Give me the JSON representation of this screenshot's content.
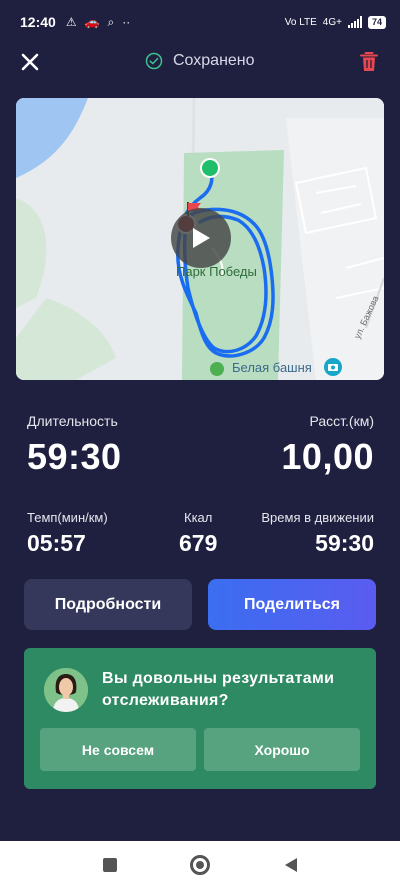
{
  "status_bar": {
    "time": "12:40",
    "network": "4G+",
    "volte": "Vo LTE",
    "battery": "74"
  },
  "topbar": {
    "saved_text": "Сохранено"
  },
  "map": {
    "park_label": "Парк Победы",
    "tower_label": "Белая башня",
    "street_label": "ул. Бажова"
  },
  "stats": {
    "duration_label": "Длительность",
    "duration_value": "59:30",
    "distance_label": "Расст.(км)",
    "distance_value": "10,00",
    "pace_label": "Темп(мин/км)",
    "pace_value": "05:57",
    "kcal_label": "Ккал",
    "kcal_value": "679",
    "moving_label": "Время в движении",
    "moving_value": "59:30"
  },
  "actions": {
    "details_label": "Подробности",
    "share_label": "Поделиться"
  },
  "feedback": {
    "question": "Вы довольны результатами отслеживания?",
    "no_label": "Не совсем",
    "yes_label": "Хорошо"
  },
  "colors": {
    "background": "#1f1f3f",
    "route": "#1a6cf0",
    "card": "#2e8a62",
    "trash": "#e8474f",
    "saved_check": "#3ec28f"
  }
}
